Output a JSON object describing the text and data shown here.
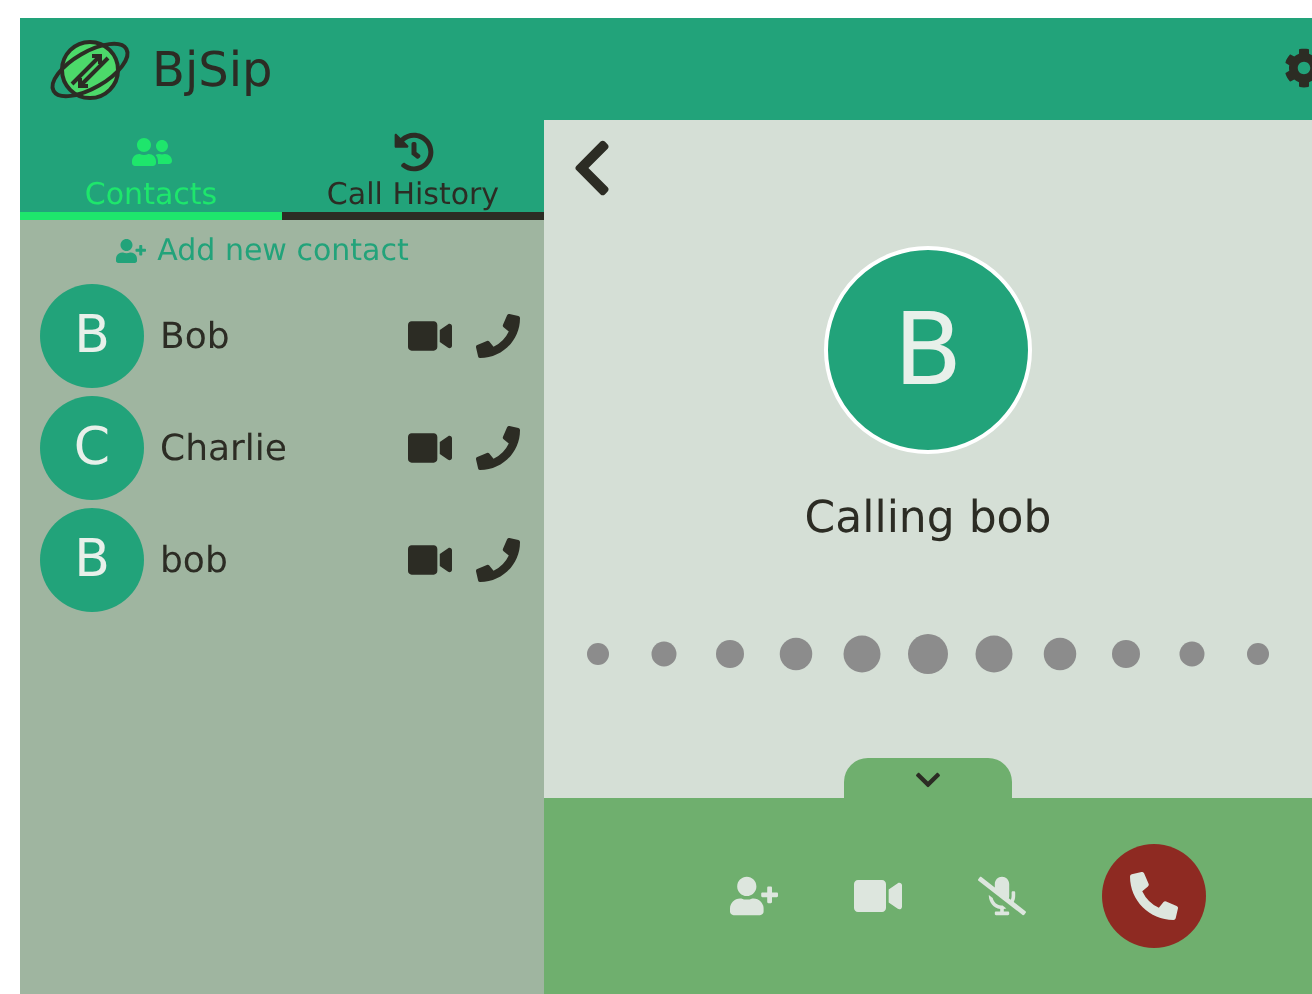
{
  "app": {
    "title": "BjSip"
  },
  "tabs": [
    {
      "label": "Contacts",
      "kind": "contacts",
      "selected": true
    },
    {
      "label": "Call History",
      "kind": "history",
      "selected": false
    }
  ],
  "add_contact": {
    "label": "Add new contact"
  },
  "contacts": [
    {
      "initial": "B",
      "name": "Bob"
    },
    {
      "initial": "C",
      "name": "Charlie"
    },
    {
      "initial": "B",
      "name": "bob"
    }
  ],
  "call": {
    "initial": "B",
    "status": "Calling bob"
  },
  "call_controls": [
    {
      "kind": "add-person"
    },
    {
      "kind": "video"
    },
    {
      "kind": "mic",
      "muted": true
    },
    {
      "kind": "hangup"
    }
  ]
}
